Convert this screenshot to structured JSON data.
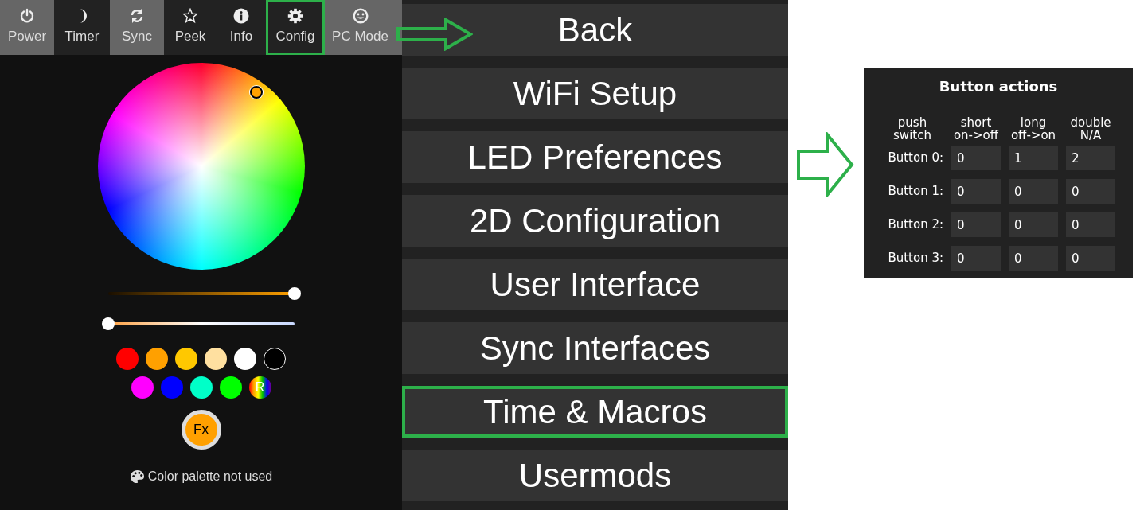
{
  "nav_tabs": [
    {
      "label": "Power",
      "selected": true,
      "highlighted": false
    },
    {
      "label": "Timer",
      "selected": false,
      "highlighted": false
    },
    {
      "label": "Sync",
      "selected": true,
      "highlighted": false
    },
    {
      "label": "Peek",
      "selected": false,
      "highlighted": false
    },
    {
      "label": "Info",
      "selected": false,
      "highlighted": false
    },
    {
      "label": "Config",
      "selected": false,
      "highlighted": true
    },
    {
      "label": "PC Mode",
      "selected": true,
      "highlighted": false
    }
  ],
  "sliders": [
    {
      "kind": "brightness",
      "level": 1
    },
    {
      "kind": "white_balance",
      "level": 0
    }
  ],
  "swatches": [
    {
      "kind": "solid",
      "color": "#ff0000"
    },
    {
      "kind": "solid",
      "color": "#ffa000"
    },
    {
      "kind": "solid",
      "color": "#ffc800"
    },
    {
      "kind": "solid",
      "color": "#ffe0a0"
    },
    {
      "kind": "solid",
      "color": "#ffffff"
    },
    {
      "kind": "solid",
      "color": "#000000"
    },
    {
      "kind": "solid",
      "color": "#ff00ff"
    },
    {
      "kind": "solid",
      "color": "#0000ff"
    },
    {
      "kind": "solid",
      "color": "#00ffc8"
    },
    {
      "kind": "solid",
      "color": "#00ff00"
    },
    {
      "kind": "random",
      "label": "R"
    }
  ],
  "fx_button": "Fx",
  "palette_note": "Color palette not used",
  "menu": [
    {
      "label": "Back",
      "highlighted": false
    },
    {
      "label": "WiFi Setup",
      "highlighted": false
    },
    {
      "label": "LED Preferences",
      "highlighted": false
    },
    {
      "label": "2D Configuration",
      "highlighted": false
    },
    {
      "label": "User Interface",
      "highlighted": false
    },
    {
      "label": "Sync Interfaces",
      "highlighted": false
    },
    {
      "label": "Time & Macros",
      "highlighted": true
    },
    {
      "label": "Usermods",
      "highlighted": false
    }
  ],
  "button_actions": {
    "title": "Button actions",
    "columns": [
      {
        "lines": [
          "push",
          "switch"
        ]
      },
      {
        "lines": [
          "short",
          "on->off"
        ]
      },
      {
        "lines": [
          "long",
          "off->on"
        ]
      },
      {
        "lines": [
          "double",
          "N/A"
        ]
      }
    ],
    "rows": [
      {
        "label": "Button 0:",
        "values": [
          "0",
          "1",
          "2"
        ]
      },
      {
        "label": "Button 1:",
        "values": [
          "0",
          "0",
          "0"
        ]
      },
      {
        "label": "Button 2:",
        "values": [
          "0",
          "0",
          "0"
        ]
      },
      {
        "label": "Button 3:",
        "values": [
          "0",
          "0",
          "0"
        ]
      }
    ]
  }
}
